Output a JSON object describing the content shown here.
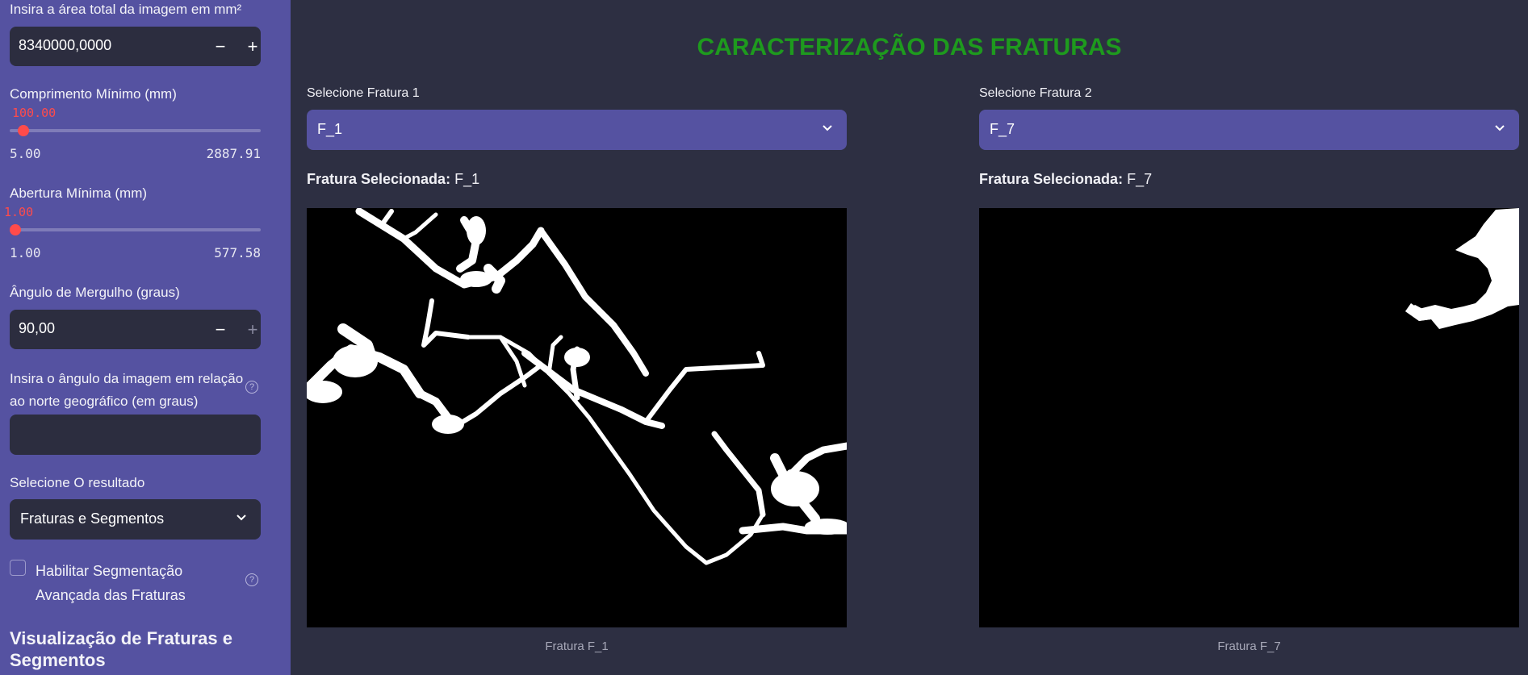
{
  "sidebar": {
    "area_label": "Insira a área total da imagem em mm²",
    "area_value": "8340000,0000",
    "minus_glyph": "−",
    "plus_glyph": "+",
    "comprimento": {
      "label": "Comprimento Mínimo (mm)",
      "value": "100.00",
      "min": "5.00",
      "max": "2887.91",
      "fraction": 0.033
    },
    "abertura": {
      "label": "Abertura Mínima (mm)",
      "value": "1.00",
      "min": "1.00",
      "max": "577.58",
      "fraction": 0.0
    },
    "angulo_label": "Ângulo de Mergulho (graus)",
    "angulo_value": "90,00",
    "norte_label_line1": "Insira o ângulo da imagem em relação",
    "norte_label_line2": "ao norte geográfico (em graus)",
    "norte_value": "",
    "help_glyph": "?",
    "resultado_label": "Selecione O resultado",
    "resultado_value": "Fraturas e Segmentos",
    "checkbox_label": "Habilitar Segmentação Avançada das Fraturas",
    "checkbox_checked": false,
    "heading": "Visualização de Fraturas e Segmentos"
  },
  "main": {
    "title": "CARACTERIZAÇÃO DAS FRATURAS",
    "left": {
      "select_label": "Selecione Fratura 1",
      "select_value": "F_1",
      "caption_bold": "Fratura Selecionada:",
      "caption_value": "F_1",
      "image_caption": "Fratura F_1"
    },
    "right": {
      "select_label": "Selecione Fratura 2",
      "select_value": "F_7",
      "caption_bold": "Fratura Selecionada:",
      "caption_value": "F_7",
      "image_caption": "Fratura F_7"
    }
  },
  "colors": {
    "sidebar_bg": "#5552a1",
    "main_bg": "#2d2f42",
    "input_bg": "#2c2d3f",
    "select_bg": "#5552a1",
    "accent_red": "#ff4b4b",
    "title_green": "#1e9a1e"
  }
}
